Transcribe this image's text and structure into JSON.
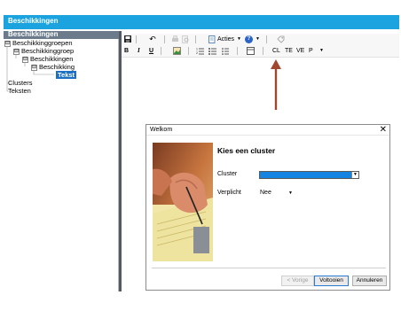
{
  "app": {
    "title": "Beschikkingen"
  },
  "tree": {
    "header": "Beschikkingen",
    "items": [
      {
        "label": "Beschikkinggroepen",
        "expander": "⊟"
      },
      {
        "label": "Beschikkinggroep",
        "expander": "⊟"
      },
      {
        "label": "Beschikkingen",
        "expander": "⊟"
      },
      {
        "label": "Beschikking",
        "expander": "⊟"
      },
      {
        "label": "Tekst"
      },
      {
        "label": "Clusters"
      },
      {
        "label": "Teksten"
      }
    ]
  },
  "toolbar": {
    "undo_icon": "↶",
    "acties_label": "Acties",
    "help_icon": "?",
    "bold": "B",
    "italic": "I",
    "underline": "U",
    "tags": [
      "CL",
      "TE",
      "VE",
      "P"
    ]
  },
  "dialog": {
    "title": "Welkom",
    "close": "✕",
    "heading": "Kies een cluster",
    "cluster_label": "Cluster",
    "cluster_value": "",
    "verplicht_label": "Verplicht",
    "verplicht_value": "Nee",
    "buttons": {
      "previous": "< Vorige",
      "finish": "Voltooien",
      "cancel": "Annuleren"
    }
  },
  "colors": {
    "titlebar": "#1aa3de",
    "selection": "#1c6fc2",
    "arrow": "#a0472f"
  }
}
